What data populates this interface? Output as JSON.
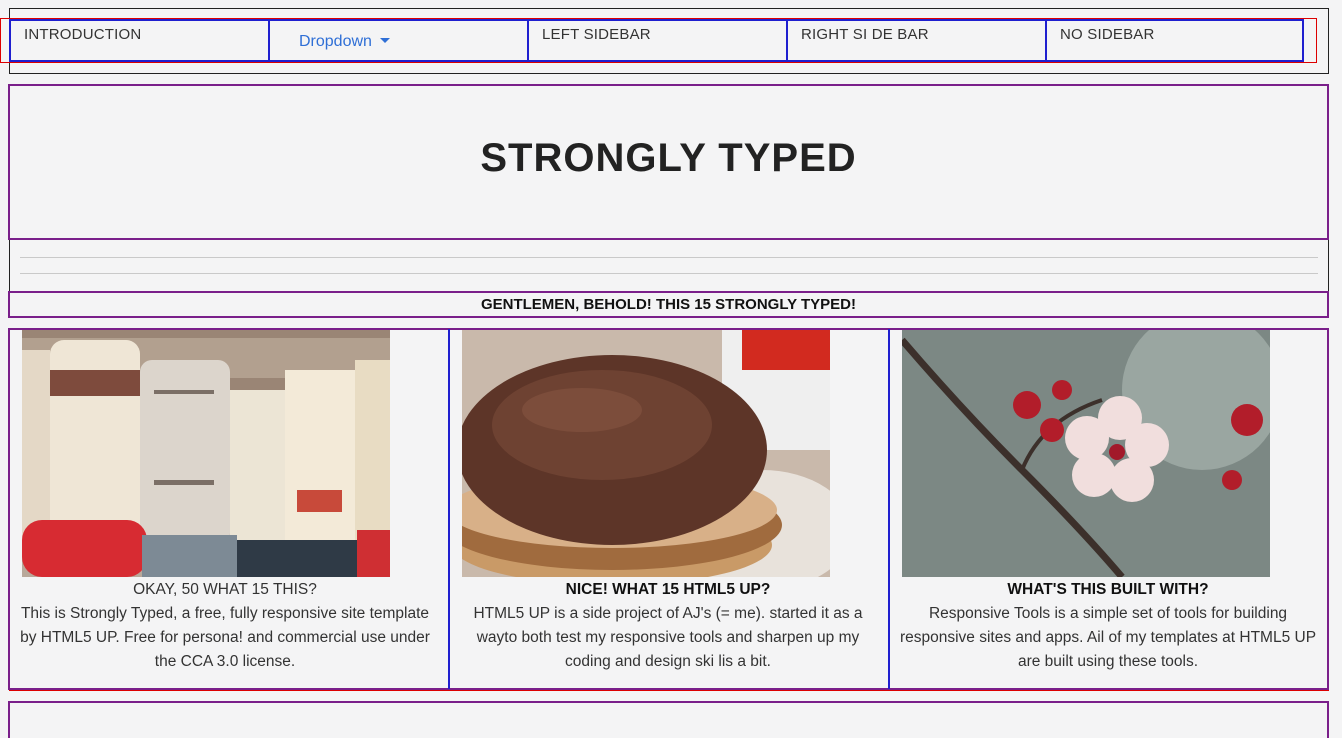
{
  "nav": {
    "items": [
      {
        "label": "INTRODUCTION"
      },
      {
        "label": "Dropdown"
      },
      {
        "label": "LEFT SIDEBAR"
      },
      {
        "label": "RIGHT SI DE BAR"
      },
      {
        "label": "NO SIDEBAR"
      }
    ]
  },
  "header": {
    "title": "STRONGLY TYPED"
  },
  "banner": {
    "text": "GENTLEMEN, BEHOLD! THIS 15 STRONGLY TYPED!"
  },
  "features": [
    {
      "title": "OKAY, 50 WHAT 15 THIS?",
      "body": "This is Strongly Typed, a free, fully responsive site template by HTML5 UP. Free for persona! and commercial use under the CCA 3.0 license."
    },
    {
      "title": "NICE! WHAT 15 HTML5 UP?",
      "body": "HTML5 UP is a side project of AJ's (= me). started it as a wayto both test my responsive tools and sharpen up my coding and design ski lis a bit."
    },
    {
      "title": "WHAT'S THIS BUILT WITH?",
      "body": "Responsive Tools is a simple set of tools for building responsive sites and apps. Ail of my templates at HTML5 UP are built using these tools."
    }
  ],
  "colors": {
    "nav_border": "#1f1fcf",
    "section_border": "#7a1f8a",
    "outline_red": "#dd0000",
    "link": "#2f6fd6"
  },
  "icons": {
    "dropdown": "caret-down-icon"
  }
}
